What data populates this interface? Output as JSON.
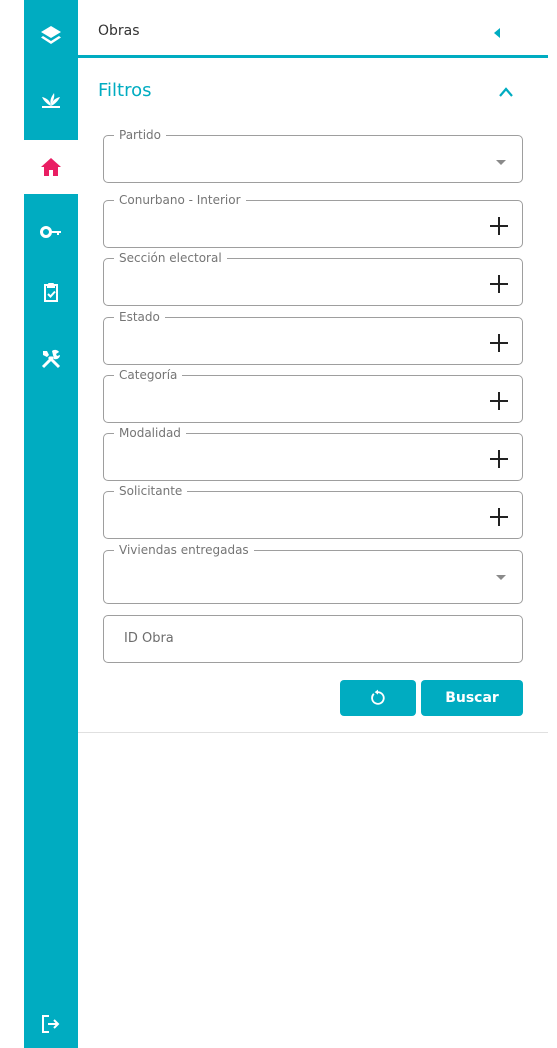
{
  "sidebar": {
    "items": [
      {
        "icon": "layers-icon"
      },
      {
        "icon": "plant-icon"
      },
      {
        "icon": "home-icon",
        "active": true
      },
      {
        "icon": "key-icon"
      },
      {
        "icon": "clipboard-check-icon"
      },
      {
        "icon": "tools-icon"
      }
    ],
    "logout_icon": "logout-icon",
    "accent": "#00acc1",
    "active_icon_color": "#e91e63"
  },
  "header": {
    "title": "Obras"
  },
  "filters": {
    "title": "Filtros",
    "fields": [
      {
        "label": "Partido",
        "kind": "select"
      },
      {
        "label": "Conurbano - Interior",
        "kind": "multi"
      },
      {
        "label": "Sección electoral",
        "kind": "multi"
      },
      {
        "label": "Estado",
        "kind": "multi"
      },
      {
        "label": "Categoría",
        "kind": "multi"
      },
      {
        "label": "Modalidad",
        "kind": "multi"
      },
      {
        "label": "Solicitante",
        "kind": "multi"
      },
      {
        "label": "Viviendas entregadas",
        "kind": "select"
      }
    ],
    "id_placeholder": "ID Obra",
    "search_label": "Buscar"
  }
}
